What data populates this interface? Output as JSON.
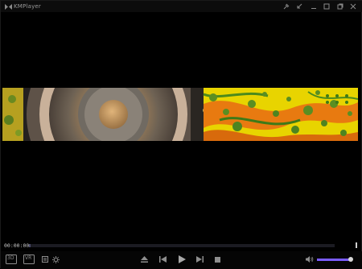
{
  "app": {
    "title": "KMPlayer"
  },
  "titlebar": {
    "buttons": [
      "pin-icon",
      "shrink-icon",
      "minimize-icon",
      "maximize-icon",
      "close-icon"
    ]
  },
  "playback": {
    "time": "00:00:00",
    "progress": 0.0,
    "volume": 0.95
  },
  "controls": {
    "left": [
      "3d-icon",
      "vr-icon",
      "playlist-icon",
      "settings-icon"
    ],
    "center": [
      "eject-icon",
      "previous-icon",
      "play-icon",
      "next-icon",
      "stop-icon"
    ],
    "right": [
      "volume-icon"
    ],
    "labels": {
      "threed": "3D",
      "vr": "VR"
    }
  },
  "colors": {
    "accent": "#7a5cff"
  }
}
